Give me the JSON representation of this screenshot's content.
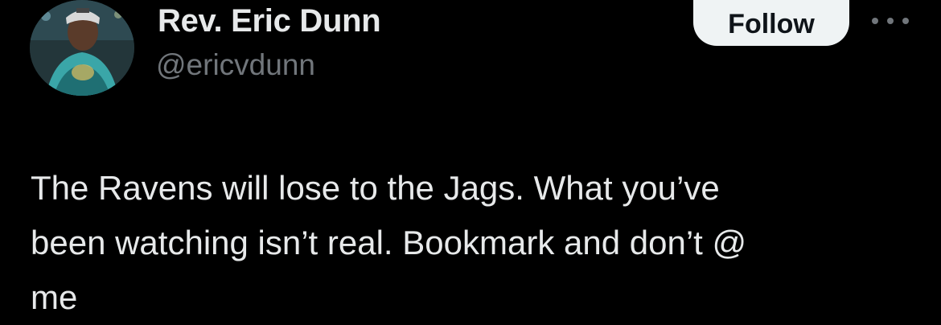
{
  "user": {
    "display_name": "Rev. Eric Dunn",
    "handle": "@ericvdunn",
    "avatar_icon": "profile-photo"
  },
  "actions": {
    "follow_label": "Follow",
    "more_icon": "ellipsis-icon"
  },
  "tweet": {
    "text": "The Ravens will lose to the Jags. What you’ve\nbeen watching isn’t real. Bookmark and don’t @\nme"
  },
  "colors": {
    "background": "#000000",
    "primary_text": "#e7e9ea",
    "secondary_text": "#71767b",
    "follow_button_bg": "#eff3f4",
    "follow_button_text": "#0f1419"
  }
}
